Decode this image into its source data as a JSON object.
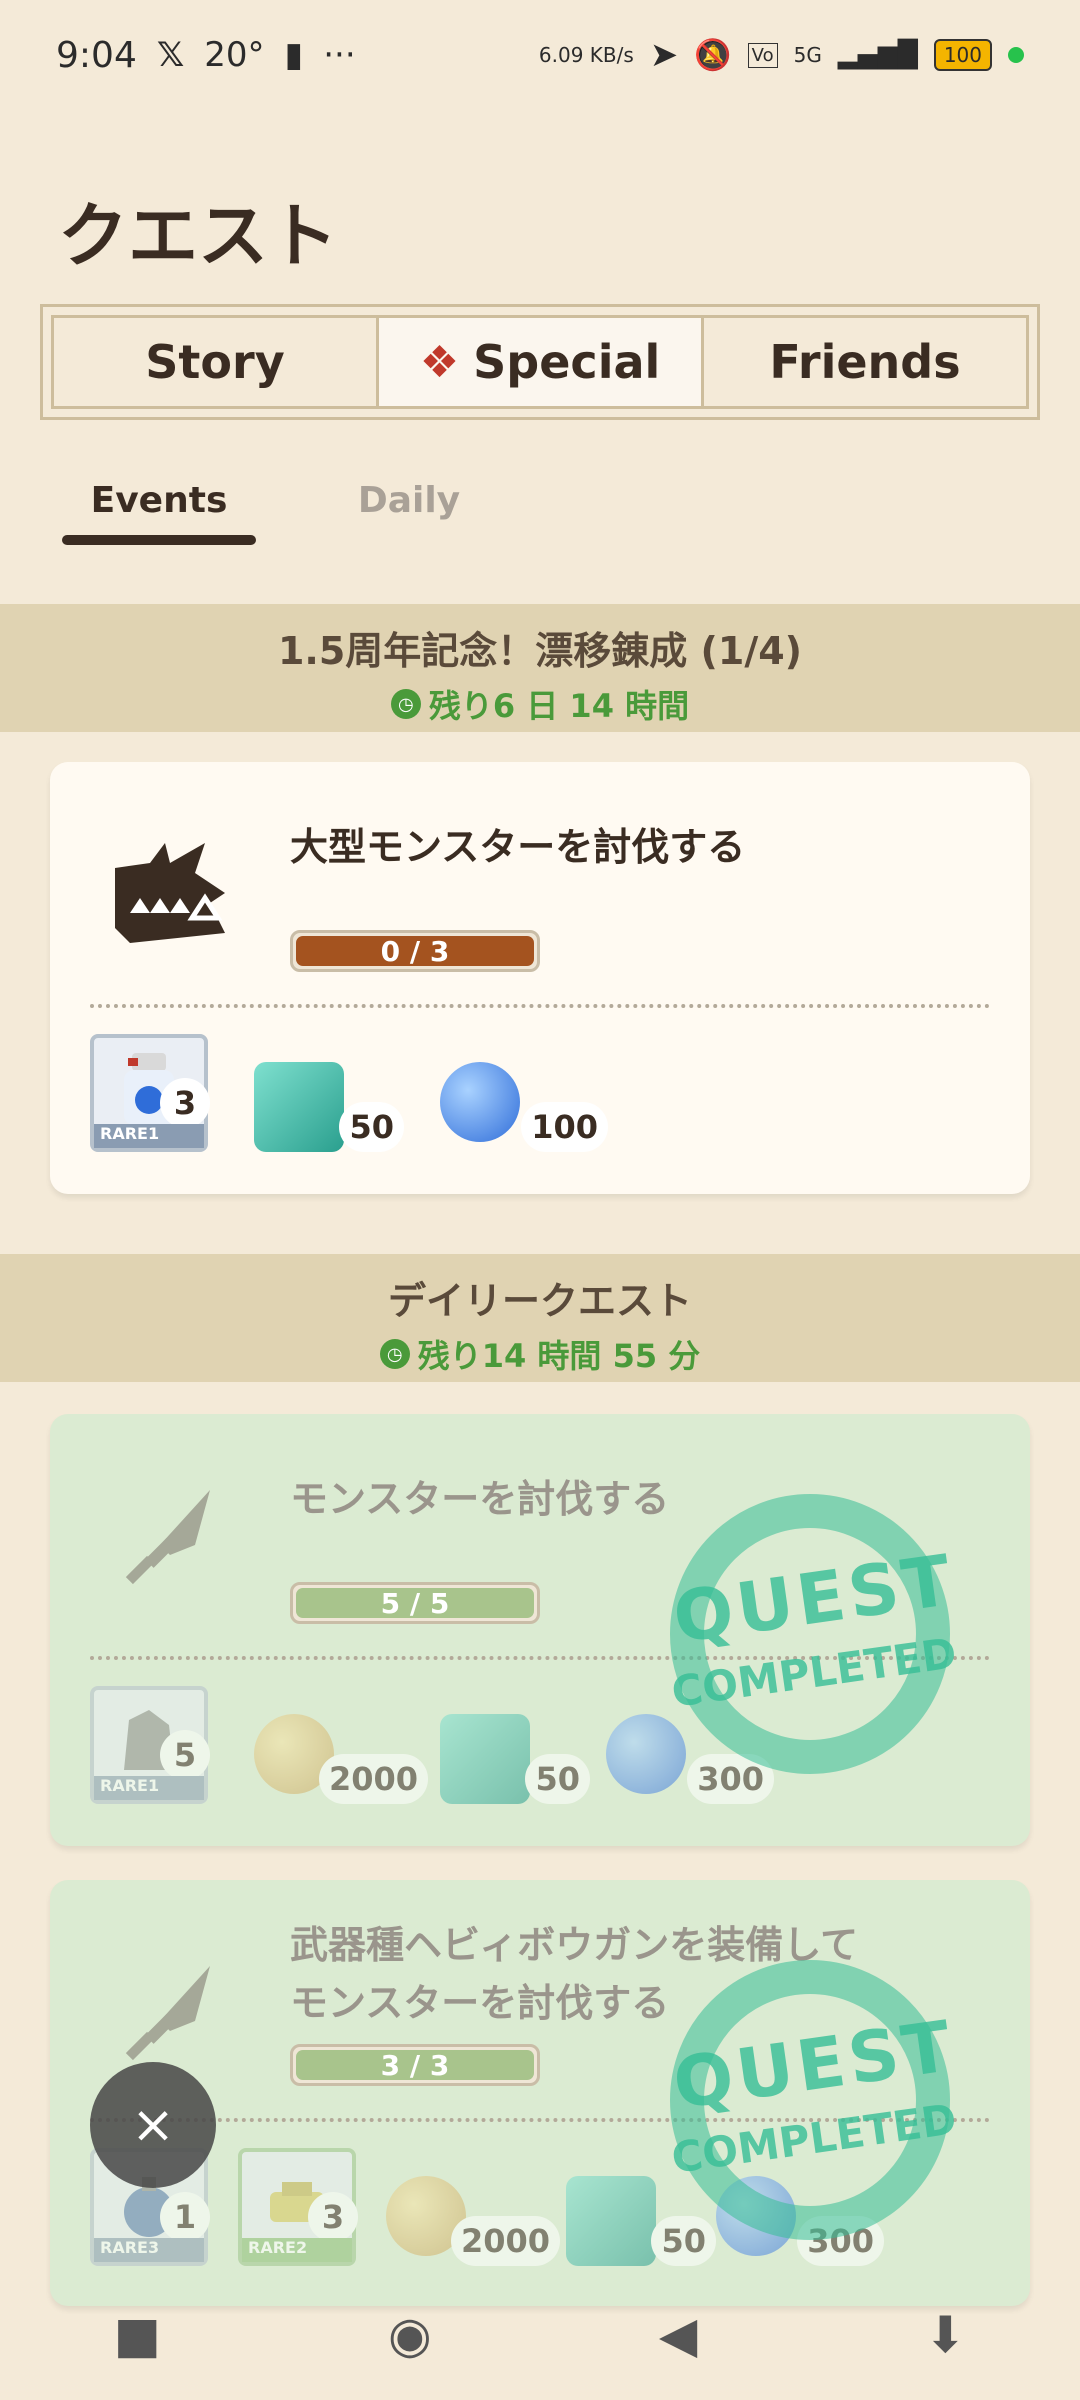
{
  "status": {
    "time": "9:04",
    "temp": "20°",
    "net_speed": "6.09 KB/s",
    "network": "5G",
    "battery": "100"
  },
  "page_title": "クエスト",
  "tabs": [
    {
      "label": "Story"
    },
    {
      "label": "Special",
      "icon": "special-emblem-icon"
    },
    {
      "label": "Friends"
    }
  ],
  "subtabs": [
    {
      "label": "Events"
    },
    {
      "label": "Daily"
    }
  ],
  "sections": [
    {
      "title": "1.5周年記念！漂移錬成 (1/4)",
      "timer": "残り6 日 14 時間"
    },
    {
      "title": "デイリークエスト",
      "timer": "残り14 時間 55 分"
    }
  ],
  "quests": [
    {
      "title": "大型モンスターを討伐する",
      "progress": "0 / 3",
      "progress_fraction": 0,
      "rewards": [
        {
          "rare": "RARE1",
          "count": "3"
        },
        {
          "count": "50"
        },
        {
          "count": "100"
        }
      ]
    },
    {
      "title": "モンスターを討伐する",
      "progress": "5 / 5",
      "progress_fraction": 1,
      "completed_stamp": [
        "QUEST",
        "COMPLETED"
      ],
      "rewards": [
        {
          "rare": "RARE1",
          "count": "5"
        },
        {
          "count": "2000"
        },
        {
          "count": "50"
        },
        {
          "count": "300"
        }
      ]
    },
    {
      "title_line1": "武器種ヘビィボウガンを装備して",
      "title_line2": "モンスターを討伐する",
      "progress": "3 / 3",
      "progress_fraction": 1,
      "completed_stamp": [
        "QUEST",
        "COMPLETED"
      ],
      "rewards": [
        {
          "rare": "RARE3",
          "count": "1"
        },
        {
          "rare": "RARE2",
          "count": "3"
        },
        {
          "count": "2000"
        },
        {
          "count": "50"
        },
        {
          "count": "300"
        }
      ]
    }
  ],
  "fab_symbol": "×"
}
